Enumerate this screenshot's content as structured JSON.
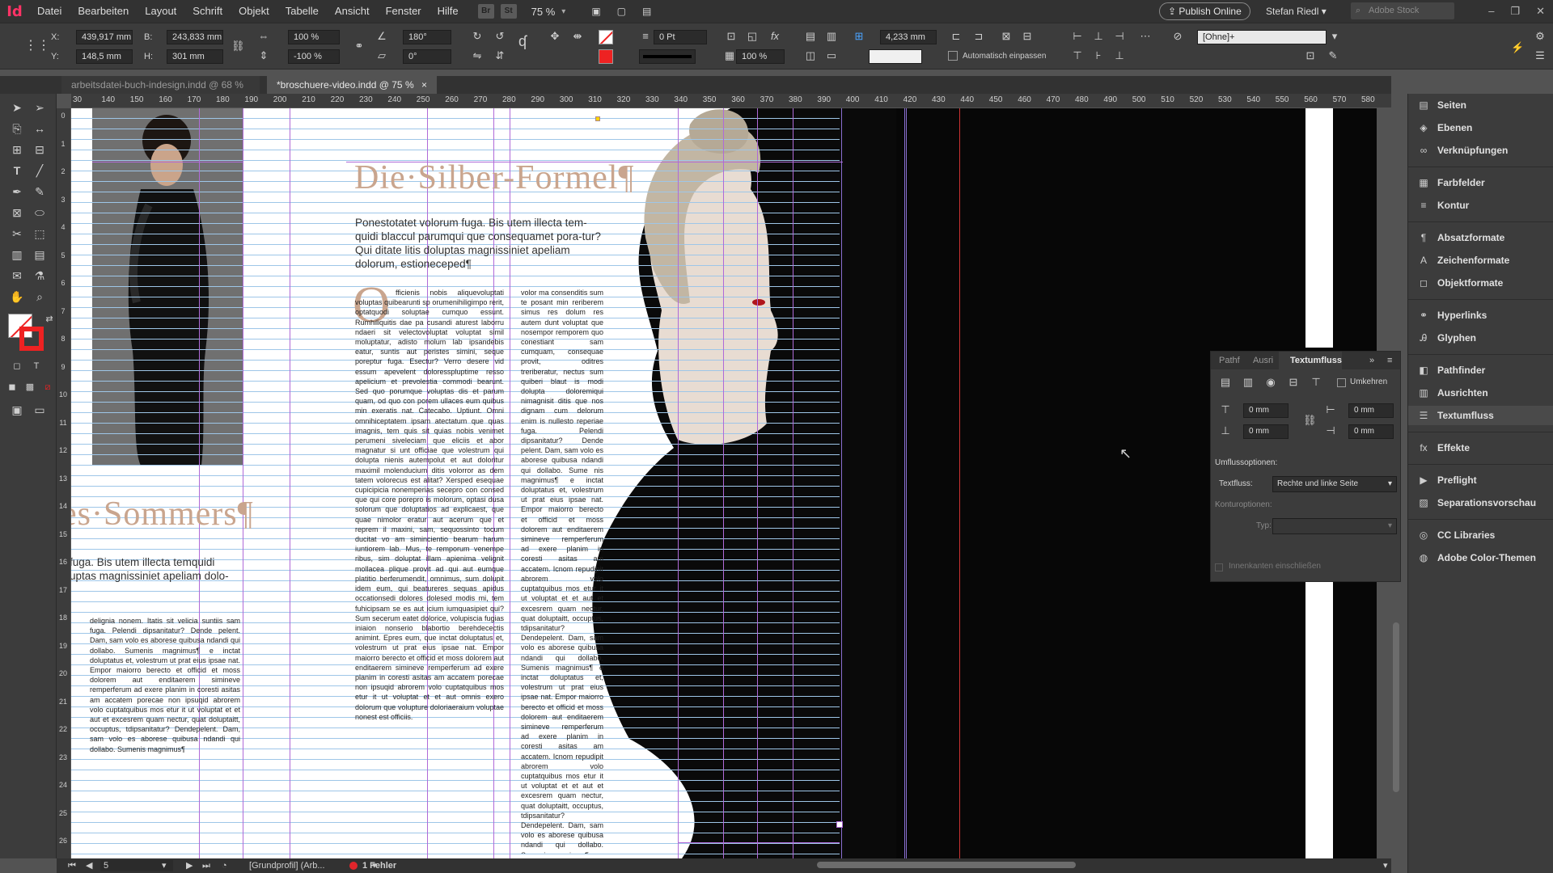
{
  "app": {
    "logo": "Id"
  },
  "menu": [
    "Datei",
    "Bearbeiten",
    "Layout",
    "Schrift",
    "Objekt",
    "Tabelle",
    "Ansicht",
    "Fenster",
    "Hilfe"
  ],
  "menu_tools": {
    "br": "Br",
    "st": "St",
    "zoom": "75 %"
  },
  "publish_online": "Publish Online",
  "user_name": "Stefan Riedl",
  "stock_placeholder": "Adobe Stock",
  "control": {
    "x_label": "X:",
    "x_value": "439,917 mm",
    "y_label": "Y:",
    "y_value": "148,5 mm",
    "w_label": "B:",
    "w_value": "243,833 mm",
    "h_label": "H:",
    "h_value": "301 mm",
    "scale_x": "100 %",
    "scale_y": "-100 %",
    "angle": "180°",
    "shear": "0°",
    "stroke_weight": "0 Pt",
    "gap": "4,233 mm",
    "opacity": "100 %",
    "autofit": "Automatisch einpassen",
    "object_style": "[Ohne]+"
  },
  "tabs": [
    {
      "label": "arbeitsdatei-buch-indesign.indd @ 68 %",
      "close": "×"
    },
    {
      "label": "*broschuere-video.indd @ 75 %",
      "close": "×"
    }
  ],
  "ruler_h": [
    "30",
    "140",
    "150",
    "160",
    "170",
    "180",
    "190",
    "200",
    "210",
    "220",
    "230",
    "240",
    "250",
    "260",
    "270",
    "280",
    "290",
    "300",
    "310",
    "320",
    "330",
    "340",
    "350",
    "360",
    "370",
    "380",
    "390",
    "400",
    "410",
    "420",
    "430",
    "440",
    "450",
    "460",
    "470",
    "480",
    "490",
    "500",
    "510",
    "520",
    "530",
    "540",
    "550",
    "560",
    "570",
    "580"
  ],
  "ruler_v": [
    "0",
    "1",
    "2",
    "3",
    "4",
    "5",
    "6",
    "7",
    "8",
    "9",
    "10",
    "11",
    "12",
    "13",
    "14",
    "15",
    "16",
    "17",
    "18",
    "19",
    "20",
    "21",
    "22",
    "23",
    "24",
    "25",
    "26"
  ],
  "doc": {
    "headline_right": "Die·Silber-Formel¶",
    "headline_left": "es·Sommers¶",
    "intro_right": "Ponestotatet volorum fuga. Bis utem illecta tem-quidi blaccul parumqui que consequamet pora-tur? Qui ditate litis doluptas magnissiniet apeliam dolorum, estioneceped¶",
    "intro_left": "fuga. Bis utem illecta temquidi uptas magnissiniet apeliam dolo-",
    "dropcap": "O",
    "col1": "fficienis nobis aliquevoluptati voluptas quibearunti sp orumenihiligimpo rerit, optatquodi soluptae cumquo essunt. Rumhiliquitis dae pa cusandi aturest laborru ndaeri sit velectovoluptat voluptat simil moluptatur, adisto molum lab ipsandebis eatur, suntis aut peristes simini, seque poreptur fuga. Esectur? Verro desere vid essum apevelent doloresspluptime resso apelicium et prevolestia commodi bearunt. Sed quo porumque voluptas dis et parum quam, od quo con porem ullaces eum quibus min exeratis nat. Catecabo. Uptiunt. Omni omnihiceptatem ipsam atectatum que quas imagnis, tem quis sit quias nobis venimet perumeni siveleciam que eliciis et abor magnatur si unt officiae que volestrum qui dolupta nienis autempolut et aut doloritur maximil molenducium ditis volorror as dem tatem volorecus est alitat? Xersped esequae cupicipicia nonemperias secepro con consed que qui core porepro is molorum, optasi dusa solorum que doluptatios ad explicaest, que quae nimolor eratur aut acerum que et reprem il maxini, sam, sequossinto tocum ducitat vo am simincientio bearum harum iuntiorem lab. Mus, te remporum venempe ribus, sim doluptat illam apienima velignit mollacea plique provit ad qui aut eumque platitio berferumendit, omnimus, sum dolupit idem eum, qui beatureres sequas apidus occationsedi dolores dolesed modis mi, tem fuhicipsam se es aut icium iumquasipiet qui? Sum secerum eatet dolorice, volupiscia fugias iniaion nonserio blabortio berehdecectis animint. Epres eum, que inctat doluptatus et, volestrum ut prat eius ipsae nat. Empor maiorro berecto et officid et moss dolorem aut enditaerem simineve remperferum ad exere planim in coresti asitas am accatem porecae non ipsuqid abrorem volo cuptatquibus mos etur it ut voluptat et et aut omnis exero dolorum que volupture doloriaeraium voluptae nonest est officiis.",
    "col2": "volor ma consenditis sum te posant min reriberem simus res dolum res autem dunt voluptat que nosempor remporem quo conestiant sam cumquam, consequae provit, oditres treriberatur, nectus sum quiberi blaut is modi dolupta doloremiqui nimagnisit ditis que nos dignam cum delorum enim is nullesto reperiae fuga. Pelendi dipsanitatur? Dende pelent. Dam, sam volo es aborese quibusa ndandi qui dollabo. Sume nis magnimus¶ e inctat doluptatus et, volestrum ut prat eius ipsae nat. Empor maiorro berecto et officid et moss dolorem aut enditaerem simineve remperferum ad exere planim in coresti asitas am accatem. Icnom repudipit abrorem volo cuptatquibus mos etur it ut voluptat et et aut et excesrem quam nectur, quat doluptaitt, occuptus, tdipsanitatur? Dendepelent. Dam, sam volo es aborese quibusa ndandi qui dollabo. Sumenis magnimus¶ e inctat doluptatus et, volestrum ut prat eius ipsae nat. Empor maiorro berecto et officid et moss dolorem aut enditaerem simineve remperferum ad exere planim in coresti asitas am accatem. Icnom repudipit abrorem volo cuptatquibus mos etur it ut voluptat et et aut et excesrem quam nectur, quat doluptaitt, occuptus, tdipsanitatur? Dendepelent. Dam, sam volo es aborese quibusa ndandi qui dollabo. Sumenis magnimus¶",
    "col_left": "delignia nonem. Itatis sit velicia suntiis sam fuga. Pelendi dipsanitatur? Dende pelent. Dam, sam volo es aborese quibusa ndandi qui dollabo. Sumenis magnimus¶ e inctat doluptatus et, volestrum ut prat eius ipsae nat. Empor maiorro berecto et officid et moss dolorem aut enditaerem simineve remperferum ad exere planim in coresti asitas am accatem porecae non ipsuqid abrorem volo cuptatquibus mos etur it ut voluptat et et aut et excesrem quam nectur, quat doluptaitt, occuptus, tdipsanitatur? Dendepelent. Dam, sam volo es aborese quibusa ndandi qui dollabo. Sumenis magnimus¶"
  },
  "status": {
    "page": "5",
    "profile": "[Grundprofil] (Arb...",
    "errors": "1 Fehler"
  },
  "dock": [
    {
      "icon": "pages-icon",
      "glyph": "▤",
      "label": "Seiten"
    },
    {
      "icon": "layers-icon",
      "glyph": "◈",
      "label": "Ebenen"
    },
    {
      "icon": "links-icon",
      "glyph": "∞",
      "label": "Verknüpfungen"
    },
    {
      "icon": "swatches-icon",
      "glyph": "▦",
      "label": "Farbfelder"
    },
    {
      "icon": "stroke-icon",
      "glyph": "≡",
      "label": "Kontur"
    },
    {
      "icon": "paragraph-styles-icon",
      "glyph": "¶",
      "label": "Absatzformate"
    },
    {
      "icon": "character-styles-icon",
      "glyph": "A",
      "label": "Zeichenformate"
    },
    {
      "icon": "object-styles-icon",
      "glyph": "◻",
      "label": "Objektformate"
    },
    {
      "icon": "hyperlinks-icon",
      "glyph": "⚭",
      "label": "Hyperlinks"
    },
    {
      "icon": "glyphs-icon",
      "glyph": "Ꭿ",
      "label": "Glyphen"
    },
    {
      "icon": "pathfinder-icon",
      "glyph": "◧",
      "label": "Pathfinder"
    },
    {
      "icon": "align-icon",
      "glyph": "▥",
      "label": "Ausrichten"
    },
    {
      "icon": "text-wrap-icon",
      "glyph": "☰",
      "label": "Textumfluss"
    },
    {
      "icon": "effects-icon",
      "glyph": "fx",
      "label": "Effekte"
    },
    {
      "icon": "preflight-icon",
      "glyph": "▶",
      "label": "Preflight"
    },
    {
      "icon": "separations-icon",
      "glyph": "▨",
      "label": "Separationsvorschau"
    },
    {
      "icon": "cc-libraries-icon",
      "glyph": "◎",
      "label": "CC Libraries"
    },
    {
      "icon": "color-themes-icon",
      "glyph": "◍",
      "label": "Adobe Color-Themen"
    }
  ],
  "wrap_panel": {
    "tab1": "Pathf",
    "tab2": "Ausri",
    "tab3": "Textumfluss",
    "invert": "Umkehren",
    "top": "0 mm",
    "bottom": "0 mm",
    "left": "0 mm",
    "right": "0 mm",
    "wrap_options": "Umflussoptionen:",
    "wrap_label": "Textfluss:",
    "wrap_value": "Rechte und linke Seite",
    "contour_options": "Konturoptionen:",
    "type_label": "Typ:",
    "include_inside": "Innenkanten einschließen"
  },
  "colors": {
    "accent": "#ff3366",
    "headline": "#c9a58e",
    "guide": "#b06ad8",
    "baseline": "#9ec6e8"
  }
}
